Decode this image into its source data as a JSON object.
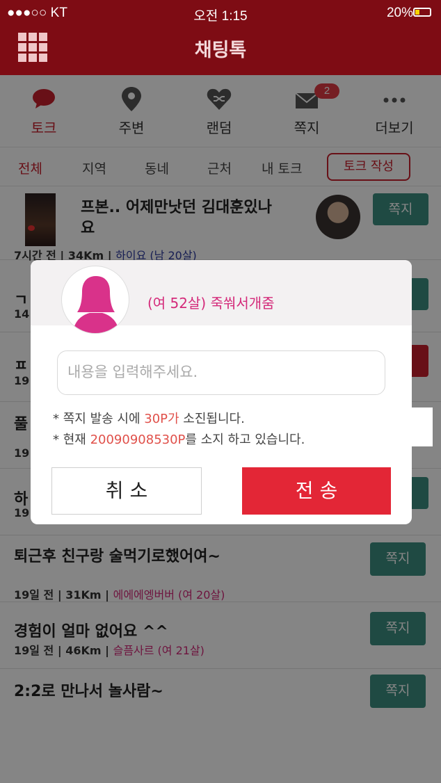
{
  "status": {
    "carrier": "●●●○○ KT",
    "time": "오전 1:15",
    "battery": "20%"
  },
  "header": {
    "title": "채팅톡"
  },
  "nav": [
    {
      "label": "토크",
      "icon": "chat-bubble-icon",
      "active": true
    },
    {
      "label": "주변",
      "icon": "location-pin-icon"
    },
    {
      "label": "랜덤",
      "icon": "shuffle-heart-icon"
    },
    {
      "label": "쪽지",
      "icon": "envelope-icon",
      "badge": "2"
    },
    {
      "label": "더보기",
      "icon": "more-dots-icon"
    }
  ],
  "subtabs": [
    "전체",
    "지역",
    "동네",
    "근처",
    "내 토크"
  ],
  "write_button": "토크 작성",
  "message_button": "쪽지",
  "rows": [
    {
      "title": "프본..    어제만낫던 김대훈있나",
      "title2": "요",
      "meta": "7시간 전 | 34Km | ",
      "nick": "하이요 (남 20살)"
    },
    {
      "title": "ㄱ",
      "meta": "14"
    },
    {
      "title": "ㅍ",
      "meta": "19"
    },
    {
      "title": "풀",
      "meta": "19"
    },
    {
      "title": "하",
      "meta": "19"
    },
    {
      "title": "퇴근후 친구랑 술먹기로했어여~",
      "meta": "19일 전 | 31Km | ",
      "nick": "에에에엥버버 (여 20살)"
    },
    {
      "title": "경험이 얼마 없어요 ^^",
      "meta": "19일 전 | 46Km | ",
      "nick": "슬픔사르 (여 21살)"
    },
    {
      "title": "2:2로 만나서 놀사람~",
      "meta": ""
    }
  ],
  "dialog": {
    "recipient": "(여 52살) 죽쒀서개줌",
    "placeholder": "내용을 입력해주세요.",
    "note1_pre": "* 쪽지 발송 시에 ",
    "note1_hl": "30P가",
    "note1_post": " 소진됩니다.",
    "note2_pre": "* 현재 ",
    "note2_hl": "20090908530P",
    "note2_post": "를 소지 하고 있습니다.",
    "cancel": "취 소",
    "send": "전 송"
  }
}
